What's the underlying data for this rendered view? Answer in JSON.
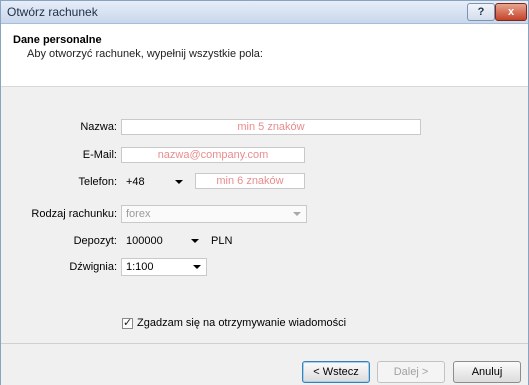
{
  "window": {
    "title": "Otwórz rachunek",
    "help_label": "?",
    "close_label": "x"
  },
  "header": {
    "title": "Dane personalne",
    "subtitle": "Aby otworzyć rachunek, wypełnij wszystkie pola:"
  },
  "form": {
    "name": {
      "label": "Nazwa:",
      "placeholder": "min 5 znaków"
    },
    "email": {
      "label": "E-Mail:",
      "placeholder": "nazwa@company.com"
    },
    "phone": {
      "label": "Telefon:",
      "prefix": "+48",
      "placeholder": "min 6 znaków"
    },
    "account_type": {
      "label": "Rodzaj rachunku:",
      "value": "forex"
    },
    "deposit": {
      "label": "Depozyt:",
      "value": "100000",
      "currency": "PLN"
    },
    "leverage": {
      "label": "Dźwignia:",
      "value": "1:100"
    },
    "consent": {
      "label": "Zgadzam się na otrzymywanie wiadomości",
      "checked": true
    }
  },
  "footer": {
    "back_label": "< Wstecz",
    "next_label": "Dalej >",
    "cancel_label": "Anuluj"
  }
}
